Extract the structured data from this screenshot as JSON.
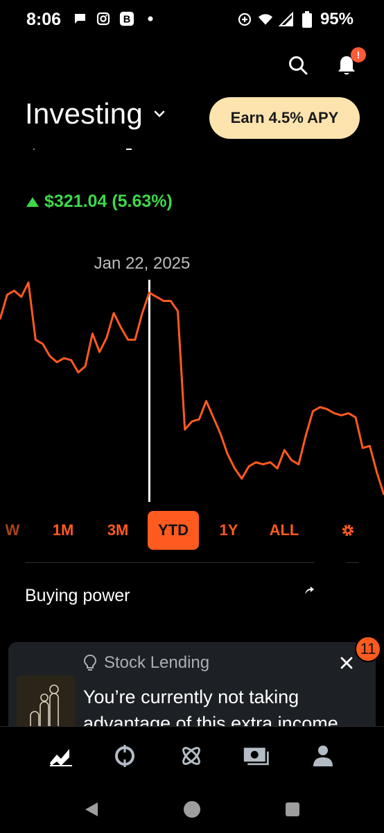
{
  "status_bar": {
    "time": "8:06",
    "battery_percent": "95%",
    "left_icons": [
      "message-icon",
      "instagram-icon",
      "b-app-icon",
      "dot-icon"
    ],
    "right_icons": [
      "data-saver-icon",
      "wifi-icon",
      "signal-icon",
      "battery-icon"
    ]
  },
  "header": {
    "title": "Investing",
    "earn_button_label": "Earn 4.5% APY",
    "notification_badge": "!"
  },
  "portfolio": {
    "gain_text": "$321.04 (5.63%)",
    "gain_color": "#3dd84a"
  },
  "chart_data": {
    "type": "line",
    "selected_date": "Jan 22, 2025",
    "line_color": "#ff5a1f",
    "grid": false,
    "values": [
      62,
      74,
      76,
      73,
      80,
      52,
      50,
      44,
      41,
      43,
      42,
      36,
      39,
      55,
      46,
      53,
      65,
      58,
      52,
      52,
      65,
      75,
      73,
      71,
      71,
      66,
      8,
      12,
      13,
      22,
      14,
      6,
      -4,
      -11,
      -16,
      -10,
      -8,
      -9,
      -8,
      -11,
      -2,
      -7,
      -9,
      5,
      17,
      19,
      18,
      16,
      15,
      16,
      14,
      -1,
      0,
      -13,
      -24
    ],
    "cursor_index": 21
  },
  "range_tabs": [
    {
      "label": "W",
      "active": false
    },
    {
      "label": "1M",
      "active": false
    },
    {
      "label": "3M",
      "active": false
    },
    {
      "label": "YTD",
      "active": true
    },
    {
      "label": "1Y",
      "active": false
    },
    {
      "label": "ALL",
      "active": false
    }
  ],
  "buying_power": {
    "label": "Buying power"
  },
  "card": {
    "title": "Stock Lending",
    "body": "You’re currently not taking advantage of this extra income",
    "badge_count": "11"
  },
  "bottom_nav": [
    "chart-icon",
    "crypto-icon",
    "atom-icon",
    "cash-icon",
    "profile-icon"
  ],
  "accent_color": "#ff5a1f"
}
